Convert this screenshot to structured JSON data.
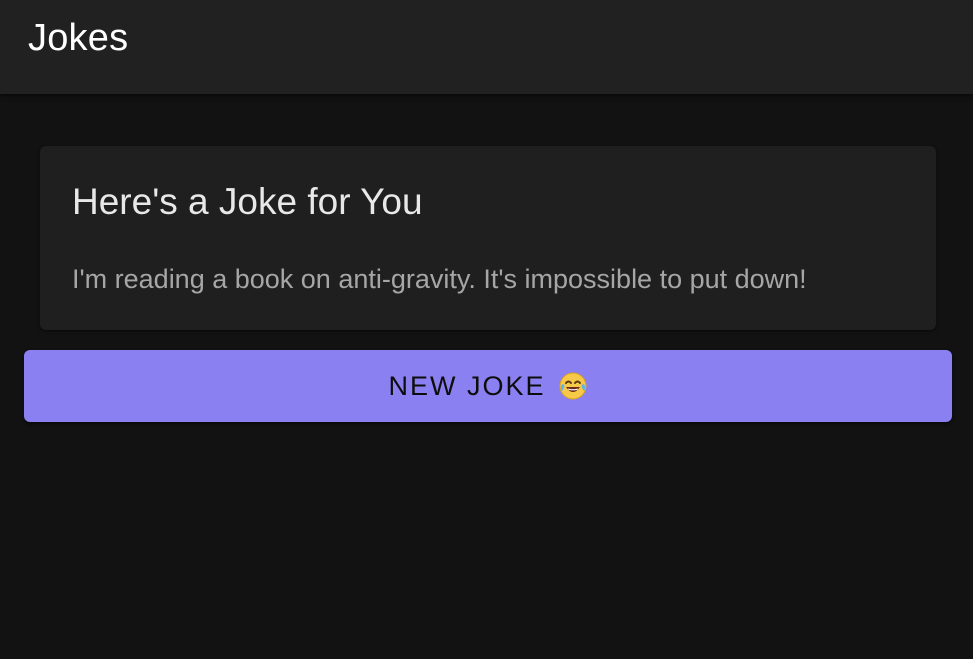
{
  "app": {
    "title": "Jokes"
  },
  "card": {
    "title": "Here's a Joke for You",
    "joke": "I'm reading a book on anti-gravity. It's impossible to put down!"
  },
  "button": {
    "label": "NEW JOKE",
    "icon": "face-with-tears-of-joy-icon"
  },
  "colors": {
    "background": "#121212",
    "appbar": "#212121",
    "card": "#1f1f1f",
    "accent": "#8b80f1"
  }
}
